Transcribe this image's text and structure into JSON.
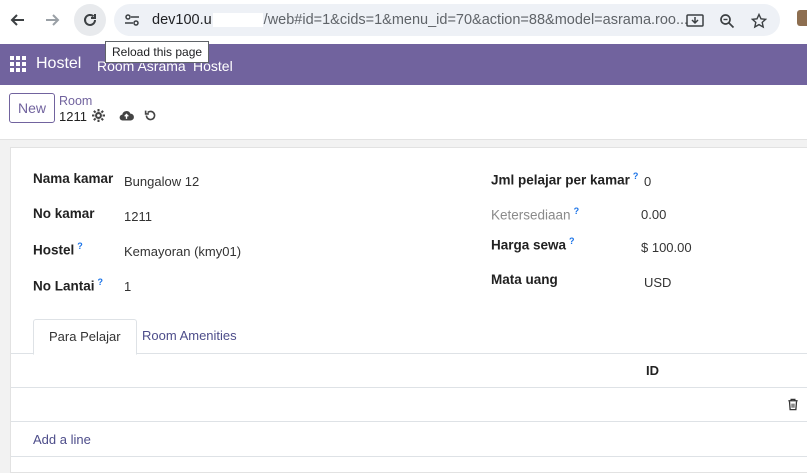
{
  "browser": {
    "url_visible_start": "dev100.u",
    "url_visible_end": "/web#id=1&cids=1&menu_id=70&action=88&model=asrama.roo...",
    "reload_tooltip": "Reload this page"
  },
  "navbar": {
    "app_name": "Hostel",
    "menu": [
      "Room Asrama",
      "Hostel"
    ]
  },
  "control_panel": {
    "new_label": "New",
    "breadcrumb": "Room",
    "record_name": "1211"
  },
  "form": {
    "left": [
      {
        "label": "Nama kamar",
        "value": "Bungalow 12",
        "help": ""
      },
      {
        "label": "No kamar",
        "value": "1211",
        "help": ""
      },
      {
        "label": "Hostel",
        "value": "Kemayoran (kmy01)",
        "help": "?"
      },
      {
        "label": "No Lantai",
        "value": "1",
        "help": "?"
      }
    ],
    "right": [
      {
        "label": "Jml pelajar per kamar",
        "value": "0",
        "help": "?"
      },
      {
        "label": "Ketersediaan",
        "value": "0.00",
        "help": "?"
      },
      {
        "label": "Harga sewa",
        "value": "$ 100.00",
        "help": "?"
      },
      {
        "label": "Mata uang",
        "value": "USD",
        "help": ""
      }
    ]
  },
  "tabs": [
    "Para Pelajar",
    "Room Amenities"
  ],
  "list": {
    "columns": [
      "ID"
    ],
    "add_line": "Add a line"
  }
}
